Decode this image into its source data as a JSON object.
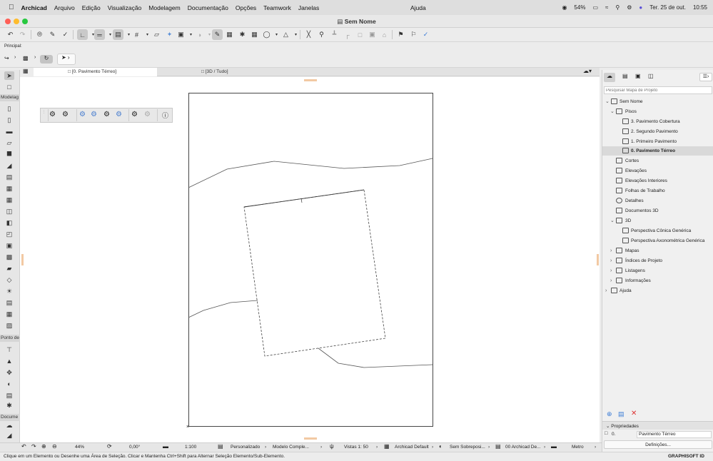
{
  "menubar": {
    "app": "Archicad",
    "items": [
      "Arquivo",
      "Edição",
      "Visualização",
      "Modelagem",
      "Documentação",
      "Opções",
      "Teamwork",
      "Janelas"
    ],
    "help": "Ajuda",
    "battery": "54%",
    "datetime": "Ter. 25 de out.",
    "time": "10:55"
  },
  "window": {
    "title": "Sem Nome"
  },
  "info": {
    "principal_label": "Principal:"
  },
  "tabs": [
    {
      "label": "[0. Pavimento Térreo]"
    },
    {
      "label": "[3D / Tudo]"
    }
  ],
  "toolbox": {
    "sections": [
      "Modelag",
      "Ponto de",
      "Docume"
    ]
  },
  "right_panel": {
    "search_placeholder": "Pesquisar Mapa de Projeto",
    "tree": [
      {
        "label": "Sem Nome"
      },
      {
        "label": "Pisos"
      },
      {
        "label": "3. Pavimento Cobertura"
      },
      {
        "label": "2. Segundo Pavimento"
      },
      {
        "label": "1. Primeiro Pavimento"
      },
      {
        "label": "0. Pavimento Térreo"
      },
      {
        "label": "Cortes"
      },
      {
        "label": "Elevações"
      },
      {
        "label": "Elevações Interiores"
      },
      {
        "label": "Folhas de Trabalho"
      },
      {
        "label": "Detalhes"
      },
      {
        "label": "Documentos 3D"
      },
      {
        "label": "3D"
      },
      {
        "label": "Perspectiva Cônica Genérica"
      },
      {
        "label": "Perspectiva Axonométrica Genérica"
      },
      {
        "label": "Mapas"
      },
      {
        "label": "Índices de Projeto"
      },
      {
        "label": "Listagens"
      },
      {
        "label": "Informações"
      },
      {
        "label": "Ajuda"
      }
    ],
    "properties_title": "Propriedades",
    "prop_id": "0.",
    "prop_value": "Pavimento Térreo",
    "settings_button": "Definições...",
    "brand": "GRAPHISOFT ID"
  },
  "status": {
    "zoom": "44%",
    "angle": "0,00°",
    "scale": "1:100",
    "layer_combo": "Personalizado",
    "model_view": "Modelo Comple...",
    "view_scale": "Vistas 1: 50",
    "pen_set": "Archicad Default",
    "override": "Sem Sobreposi...",
    "renovation": "00 Archicad De...",
    "unit": "Metro"
  },
  "hint": "Clique em um Elemento ou Desenhe uma Área de Seleção. Clicar e Mantenha Ctrl+Shift para Alternar Seleção Elemento/Sub-Elemento."
}
